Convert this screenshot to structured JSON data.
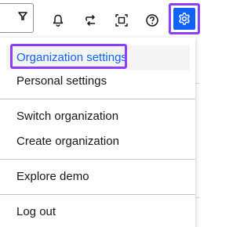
{
  "toolbar": {
    "icons": [
      "filter-icon",
      "notification-bell-icon",
      "switch-arrows-icon",
      "fit-to-screen-icon",
      "help-icon",
      "settings-icon"
    ],
    "accent_color": "#0f62fe",
    "focus_color": "#8a3ffc"
  },
  "menu": {
    "organization_settings": "Organization settings",
    "personal_settings": "Personal settings",
    "switch_organization": "Switch organization",
    "create_organization": "Create organization",
    "explore_demo": "Explore demo",
    "log_out": "Log out"
  }
}
